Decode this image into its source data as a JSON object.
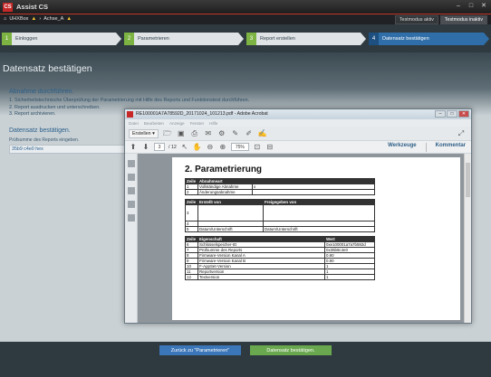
{
  "app": {
    "title": "Assist CS",
    "logo_text": "CS"
  },
  "breadcrumb": [
    "UHXBox",
    "Achse_A"
  ],
  "modes": {
    "active": "Testmodus aktiv",
    "inactive": "Testmodus inaktiv"
  },
  "steps": [
    {
      "num": "1",
      "label": "Einloggen"
    },
    {
      "num": "2",
      "label": "Parametrieren"
    },
    {
      "num": "3",
      "label": "Report erstellen"
    },
    {
      "num": "4",
      "label": "Datensatz bestätigen"
    }
  ],
  "page_title": "Datensatz bestätigen",
  "left": {
    "title": "Abnahme durchführen.",
    "lines": [
      "1. Sicherheitstechnische Überprüfung der Parametrierung mit Hilfe des Reports und Funktionstest durchführen.",
      "2. Report ausdrucken und unterschreiben.",
      "3. Report archivieren."
    ],
    "title2": "Datensatz bestätigen.",
    "checksum_label": "Prüfsumme des Reports eingeben.",
    "checksum_value": "35b9 c4e0 hex"
  },
  "acrobat": {
    "title": "RE100001A7A78592D_20171024_101213.pdf - Adobe Acrobat",
    "menu": [
      "Datei",
      "Bearbeiten",
      "Anzeige",
      "Fenster",
      "Hilfe"
    ],
    "create_label": "Erstellen",
    "page_current": "3",
    "page_total": "/ 12",
    "zoom": "75%",
    "tools_label": "Werkzeuge",
    "comment_label": "Kommentar"
  },
  "pdf": {
    "heading": "2. Parametrierung",
    "table1_headers": [
      "Zeile",
      "Abnahmeart"
    ],
    "table1_rows": [
      [
        "1",
        "Vollständige Abnahme",
        "x"
      ],
      [
        "2",
        "Änderungsabnahme",
        ""
      ]
    ],
    "table2_headers": [
      "Zeile",
      "Erstellt von",
      "Freigegeben von"
    ],
    "table2_rows": [
      [
        "3",
        "",
        ""
      ],
      [
        "4",
        "",
        ""
      ],
      [
        "5",
        "Datum/Unterschrift",
        "Datum/Unterschrift"
      ]
    ],
    "table3_headers": [
      "Zeile",
      "Eigenschaft",
      "Wert"
    ],
    "table3_rows": [
      [
        "6",
        "Schlüsselspeicher-ID",
        "0xe100001a7a7b592d"
      ],
      [
        "7",
        "Prüfsumme des Reports",
        "0x35b9c4e0"
      ],
      [
        "8",
        "Firmware-Version Kanal A",
        "0.90"
      ],
      [
        "9",
        "Firmware-Version Kanal B",
        "0.90"
      ],
      [
        "10",
        "F-AppSet-Version",
        "1"
      ],
      [
        "11",
        "Reportversion",
        "1"
      ],
      [
        "12",
        "Textversion",
        "1"
      ]
    ]
  },
  "buttons": {
    "back": "Zurück zu \"Parametrieren\"",
    "confirm": "Datensatz bestätigen."
  }
}
